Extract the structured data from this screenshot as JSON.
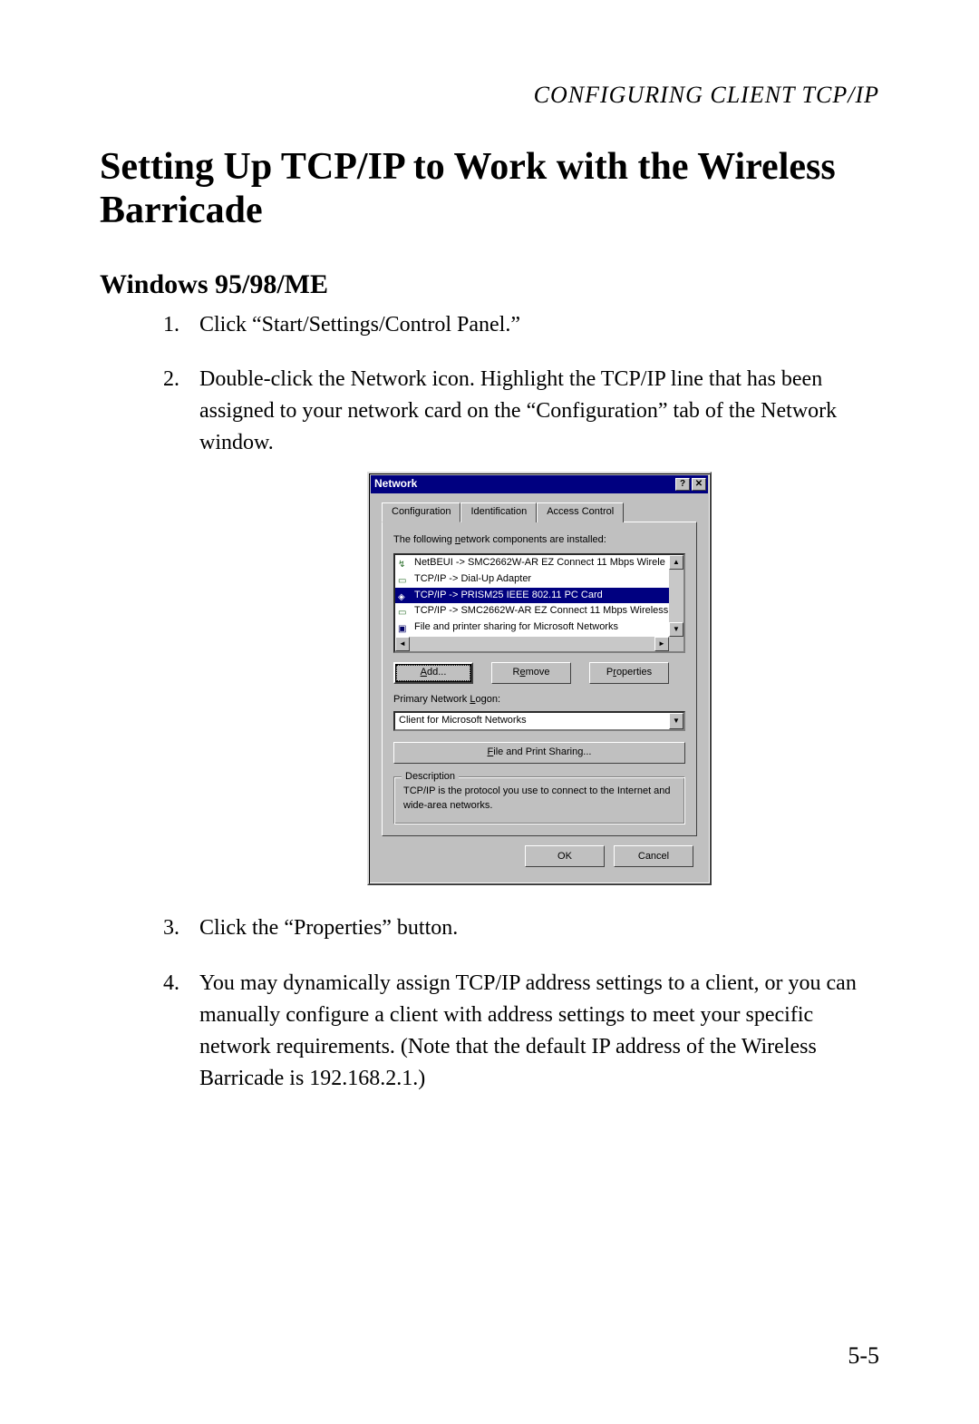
{
  "running_head": "CONFIGURING CLIENT TCP/IP",
  "heading": "Setting Up TCP/IP to Work with the Wireless Barricade",
  "subheading": "Windows 95/98/ME",
  "steps": [
    "Click “Start/Settings/Control Panel.”",
    "Double-click the Network icon. Highlight the TCP/IP line that has been assigned to your network card on the “Configuration” tab of the Network window.",
    "Click the “Properties” button.",
    "You may dynamically assign TCP/IP address settings to a client, or you can manually configure a client with address settings to meet your specific network requirements. (Note that the default IP address of the Wireless Barricade is 192.168.2.1.)"
  ],
  "dialog": {
    "title": "Network",
    "help_glyph": "?",
    "close_glyph": "✕",
    "tabs": [
      "Configuration",
      "Identification",
      "Access Control"
    ],
    "installed_label": "The following network components are installed:",
    "components": [
      {
        "label": "NetBEUI -> SMC2662W-AR EZ Connect 11 Mbps Wirele",
        "icon": "net",
        "selected": false
      },
      {
        "label": "TCP/IP -> Dial-Up Adapter",
        "icon": "adapter",
        "selected": false
      },
      {
        "label": "TCP/IP -> PRISM25 IEEE 802.11 PC Card",
        "icon": "card",
        "selected": true
      },
      {
        "label": "TCP/IP -> SMC2662W-AR EZ Connect 11 Mbps Wireless",
        "icon": "adapter",
        "selected": false
      },
      {
        "label": "File and printer sharing for Microsoft Networks",
        "icon": "share",
        "selected": false
      }
    ],
    "buttons": {
      "add": "Add...",
      "remove": "Remove",
      "properties": "Properties"
    },
    "primary_logon_label": "Primary Network Logon:",
    "primary_logon_value": "Client for Microsoft Networks",
    "file_print_sharing": "File and Print Sharing...",
    "description_legend": "Description",
    "description_text": "TCP/IP is the protocol you use to connect to the Internet and wide-area networks.",
    "ok": "OK",
    "cancel": "Cancel"
  },
  "page_number": "5-5"
}
